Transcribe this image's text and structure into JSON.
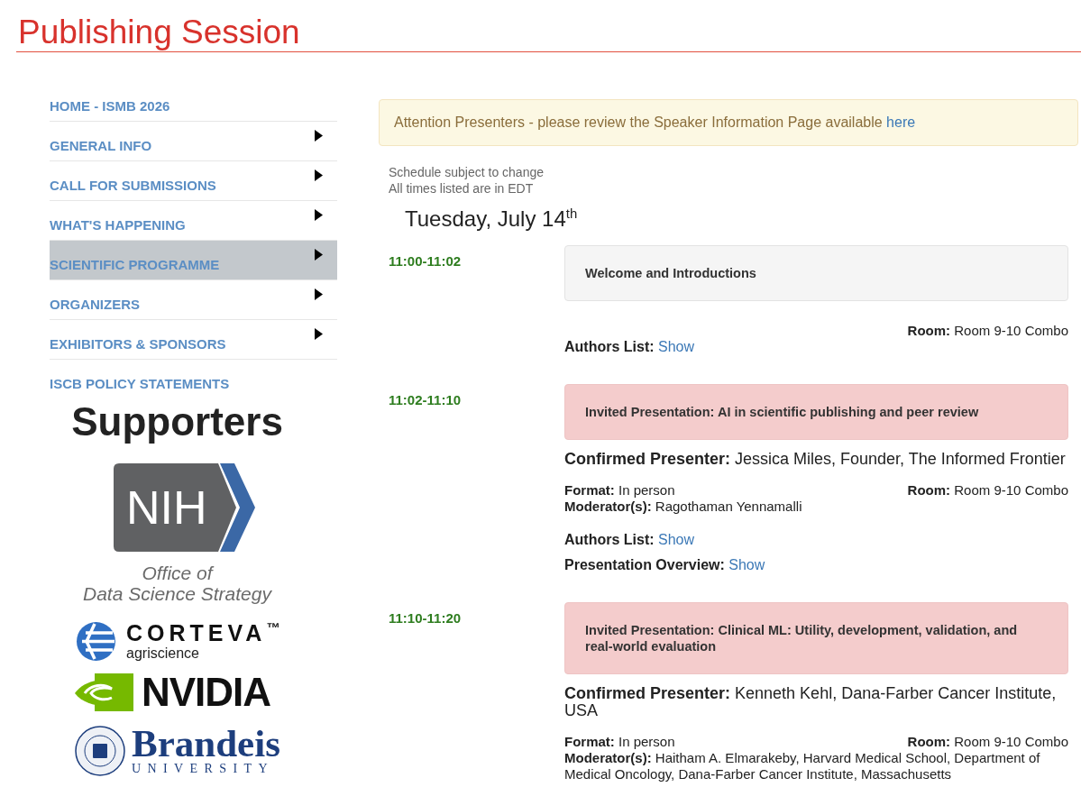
{
  "page_title": "Publishing Session",
  "nav": [
    {
      "label": "HOME - ISMB 2026",
      "submenu": false,
      "selected": false
    },
    {
      "label": "GENERAL INFO",
      "submenu": true,
      "selected": false
    },
    {
      "label": "CALL FOR SUBMISSIONS",
      "submenu": true,
      "selected": false
    },
    {
      "label": "WHAT'S HAPPENING",
      "submenu": true,
      "selected": false
    },
    {
      "label": "SCIENTIFIC PROGRAMME",
      "submenu": true,
      "selected": true
    },
    {
      "label": "ORGANIZERS",
      "submenu": true,
      "selected": false
    },
    {
      "label": "EXHIBITORS & SPONSORS",
      "submenu": true,
      "selected": false
    },
    {
      "label": "ISCB POLICY STATEMENTS",
      "submenu": false,
      "selected": false
    }
  ],
  "supporters": {
    "heading": "Supporters",
    "logos": [
      {
        "kind": "nih",
        "mark": "NIH",
        "caption": [
          "Office of",
          "Data Science Strategy"
        ]
      },
      {
        "kind": "corteva",
        "name": "CORTEVA$^{™}$",
        "tagline": "agriscience"
      },
      {
        "kind": "nvidia",
        "name": "NVIDIA"
      },
      {
        "kind": "brandeis",
        "name": "Brandeis",
        "tagline": "UNIVERSITY"
      }
    ]
  },
  "notice": {
    "text": "Attention Presenters - please review the Speaker Information Page available",
    "link": "here"
  },
  "notes": [
    "Schedule subject to change",
    "All times listed are in EDT"
  ],
  "day": "Tuesday, July 14$^{th}$",
  "sessions": [
    {
      "time": "11:00-11:02",
      "kind": "general",
      "title": "Welcome and Introductions",
      "room": "**Room:** Room 9-10 Combo",
      "links": [
        {
          "label": "Authors List:",
          "link": "Show"
        }
      ]
    },
    {
      "time": "11:02-11:10",
      "kind": "invited",
      "title": "Invited Presentation: AI in scientific publishing and peer review",
      "presenter": "**Confirmed Presenter:** Jessica Miles, Founder, The Informed Frontier",
      "room": "**Room:** Room 9-10 Combo",
      "details": [
        "**Format:** In person",
        "**Moderator(s):** Ragothaman Yennamalli"
      ],
      "links": [
        {
          "label": "Authors List:",
          "link": "Show"
        },
        {
          "label": "Presentation Overview:",
          "link": "Show"
        }
      ]
    },
    {
      "time": "11:10-11:20",
      "kind": "invited",
      "title": "Invited Presentation: Clinical ML: Utility, development, validation, and real-world evaluation",
      "presenter": "**Confirmed Presenter:** Kenneth Kehl, Dana-Farber Cancer Institute, USA",
      "room": "**Room:** Room 9-10 Combo",
      "details": [
        "**Format:** In person",
        "**Moderator(s):** Haitham A. Elmarakeby, Harvard Medical School, Department of Medical Oncology, Dana-Farber Cancer Institute, Massachusetts"
      ]
    }
  ]
}
